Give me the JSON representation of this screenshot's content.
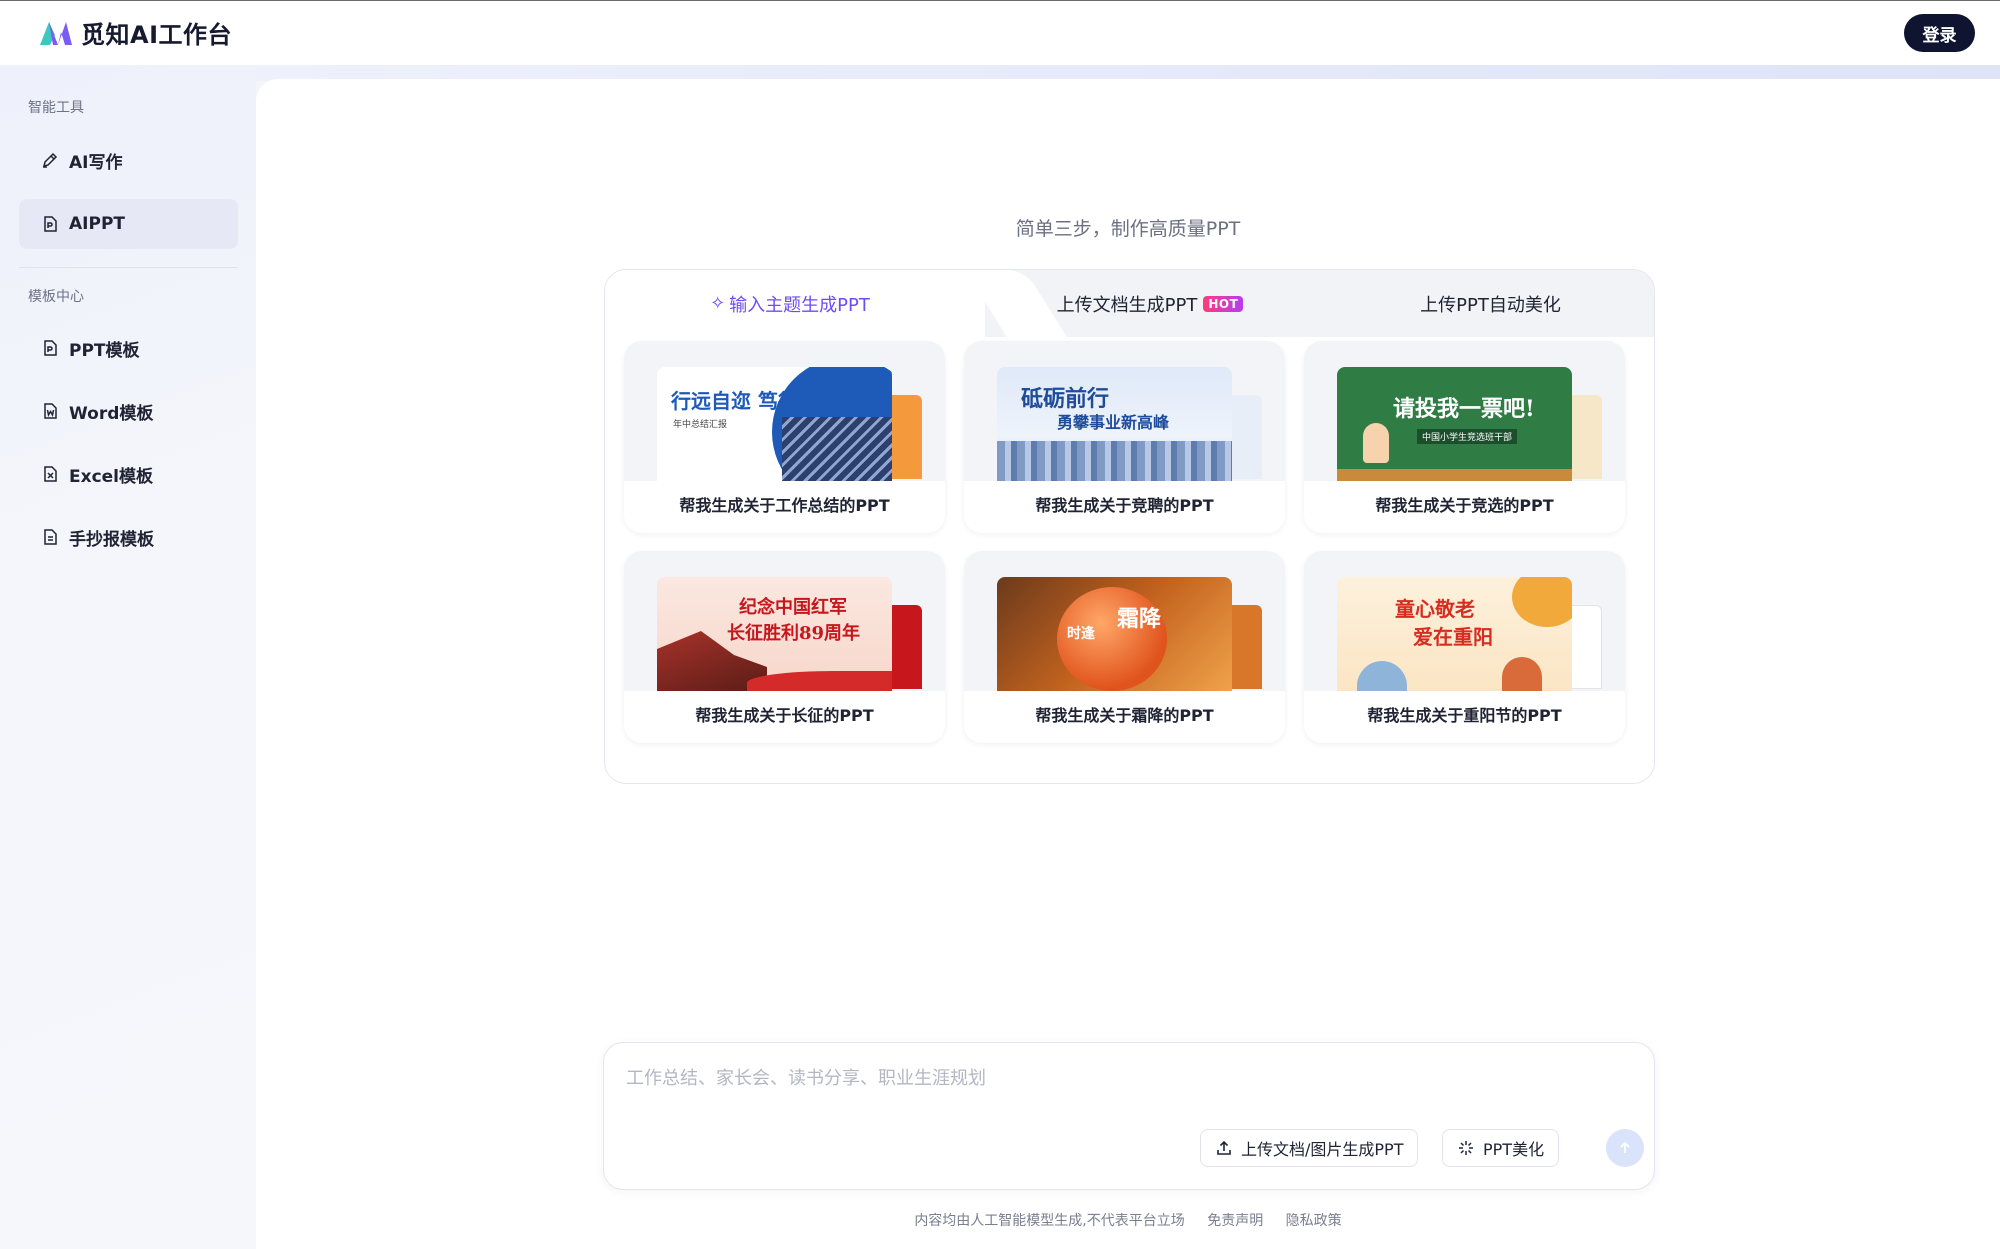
{
  "app": {
    "name": "觅知AI工作台",
    "login_label": "登录"
  },
  "sidebar": {
    "section_tools": "智能工具",
    "section_templates": "模板中心",
    "items": [
      {
        "label": "AI写作",
        "icon": "pen-icon"
      },
      {
        "label": "AIPPT",
        "icon": "ppt-file-icon",
        "active": true
      },
      {
        "label": "PPT模板",
        "icon": "ppt-template-icon"
      },
      {
        "label": "Word模板",
        "icon": "word-icon"
      },
      {
        "label": "Excel模板",
        "icon": "excel-icon"
      },
      {
        "label": "手抄报模板",
        "icon": "document-icon"
      }
    ]
  },
  "main": {
    "subtitle": "简单三步，制作高质量PPT",
    "tabs": [
      {
        "label": "输入主题生成PPT",
        "active": true
      },
      {
        "label": "上传文档生成PPT",
        "badge": "HOT"
      },
      {
        "label": "上传PPT自动美化"
      }
    ],
    "cards": [
      {
        "label": "帮我生成关于工作总结的PPT",
        "thumb_text": "行远自迩 笃行不怠",
        "thumb_sub": "年中总结汇报"
      },
      {
        "label": "帮我生成关于竞聘的PPT",
        "thumb_text": "砥砺前行",
        "thumb_sub": "勇攀事业新高峰"
      },
      {
        "label": "帮我生成关于竞选的PPT",
        "thumb_text": "请投我一票吧!",
        "thumb_sub": "中国小学生竞选班干部"
      },
      {
        "label": "帮我生成关于长征的PPT",
        "thumb_text": "纪念中国红军",
        "thumb_sub": "长征胜利89周年"
      },
      {
        "label": "帮我生成关于霜降的PPT",
        "thumb_text": "霜降",
        "thumb_sub": "时逢"
      },
      {
        "label": "帮我生成关于重阳节的PPT",
        "thumb_text": "童心敬老",
        "thumb_sub": "爱在重阳"
      }
    ]
  },
  "composer": {
    "placeholder": "工作总结、家长会、读书分享、职业生涯规划",
    "upload_label": "上传文档/图片生成PPT",
    "beautify_label": "PPT美化"
  },
  "footer": {
    "notice": "内容均由人工智能模型生成,不代表平台立场",
    "disclaimer": "免责声明",
    "privacy": "隐私政策"
  },
  "colors": {
    "accent": "#6c4cf5",
    "login_bg": "#0f1430",
    "hot_badge": "#ff3b7b"
  }
}
